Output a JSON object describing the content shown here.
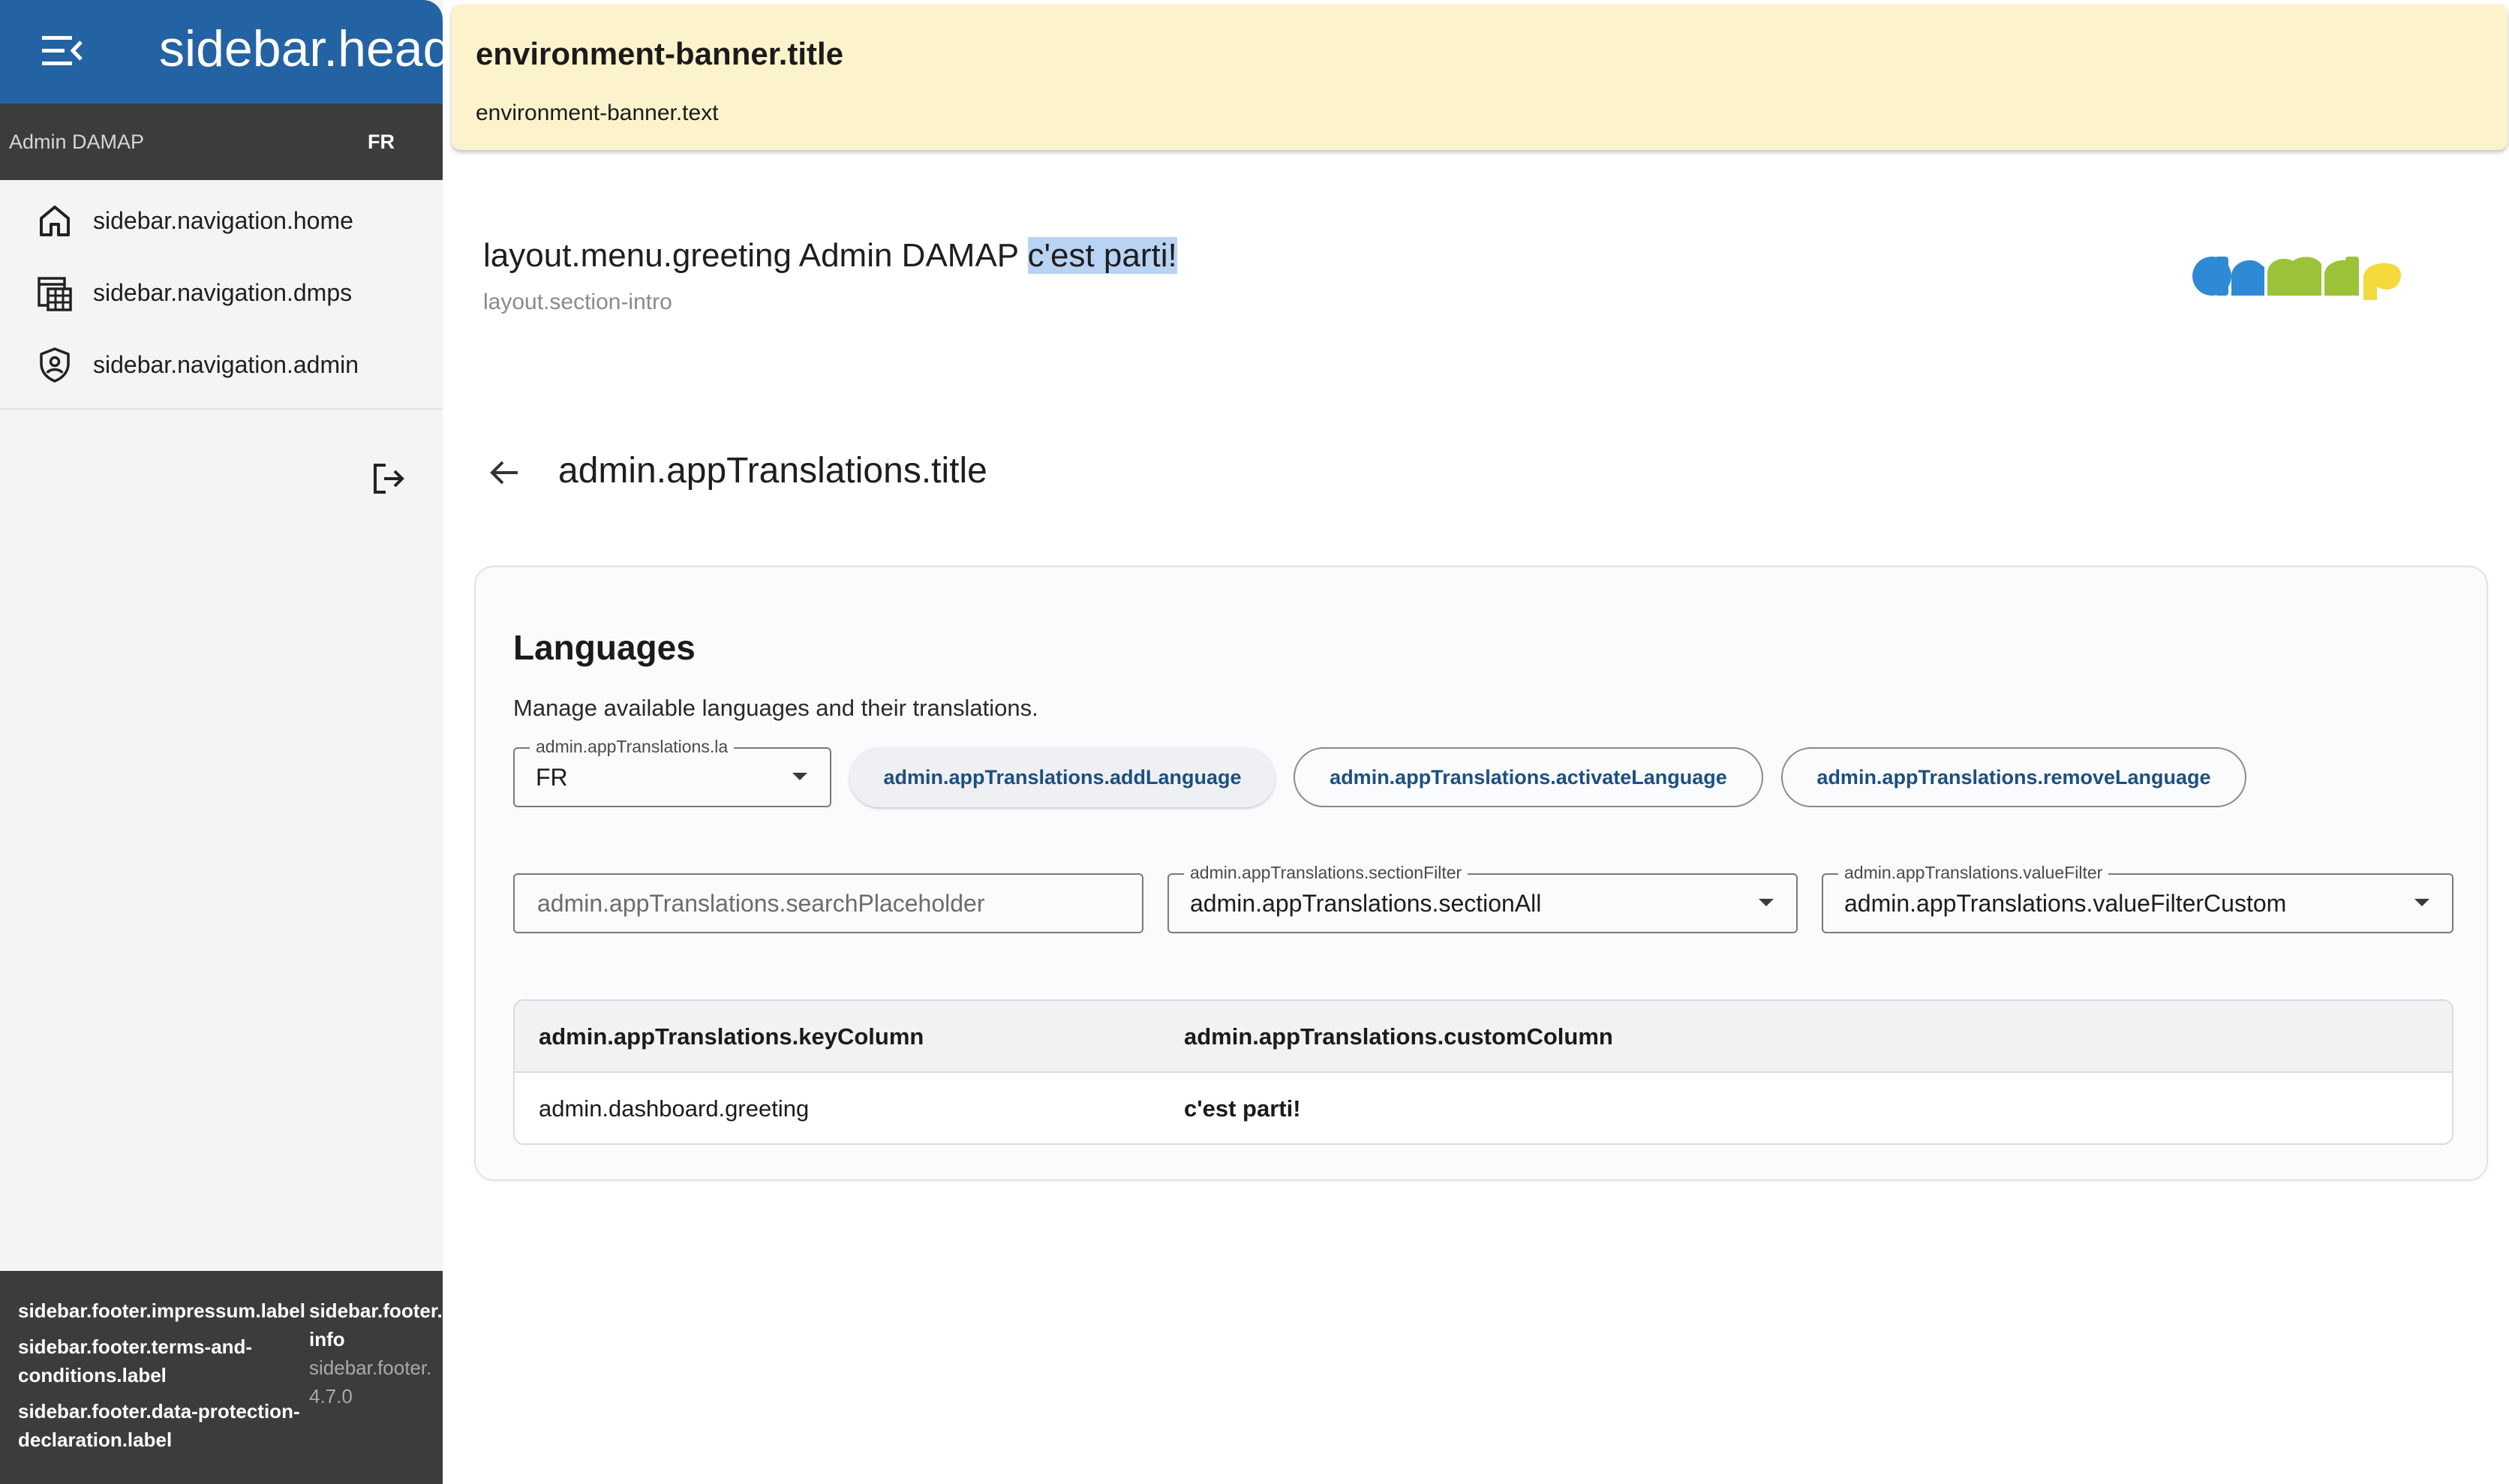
{
  "sidebar": {
    "title": "sidebar.header",
    "user": {
      "name": "Admin DAMAP",
      "language": "FR"
    },
    "nav": [
      {
        "label": "sidebar.navigation.home",
        "icon": "home-icon"
      },
      {
        "label": "sidebar.navigation.dmps",
        "icon": "table-grid-icon"
      },
      {
        "label": "sidebar.navigation.admin",
        "icon": "admin-shield-icon"
      }
    ],
    "footer": {
      "impressum": "sidebar.footer.impressum.label",
      "terms": "sidebar.footer.terms-and-conditions.label",
      "data_protection": "sidebar.footer.data-protection-declaration.label",
      "info": "sidebar.footer.",
      "info_cont": "info",
      "version_label": "sidebar.footer.",
      "version": "4.7.0"
    }
  },
  "banner": {
    "title": "environment-banner.title",
    "text": "environment-banner.text"
  },
  "header": {
    "greeting_prefix": "layout.menu.greeting Admin DAMAP ",
    "greeting_highlight": "c'est parti!",
    "section_intro": "layout.section-intro",
    "logo": "damap"
  },
  "page": {
    "title": "admin.appTranslations.title"
  },
  "languages_card": {
    "title": "Languages",
    "description": "Manage available languages and their translations.",
    "language_select": {
      "label": "admin.appTranslations.la",
      "value": "FR"
    },
    "buttons": {
      "add": "admin.appTranslations.addLanguage",
      "activate": "admin.appTranslations.activateLanguage",
      "remove": "admin.appTranslations.removeLanguage"
    },
    "search": {
      "placeholder": "admin.appTranslations.searchPlaceholder"
    },
    "section_filter": {
      "label": "admin.appTranslations.sectionFilter",
      "value": "admin.appTranslations.sectionAll"
    },
    "value_filter": {
      "label": "admin.appTranslations.valueFilter",
      "value": "admin.appTranslations.valueFilterCustom"
    },
    "table": {
      "columns": [
        "admin.appTranslations.keyColumn",
        "admin.appTranslations.customColumn"
      ],
      "rows": [
        [
          "admin.dashboard.greeting",
          "c'est parti!"
        ]
      ]
    }
  },
  "colors": {
    "sidebar_header": "#2463a3",
    "sidebar_dark": "#3c3c3c",
    "banner_bg": "#fcf3cc",
    "selection_highlight": "#b8d3f3",
    "button_text": "#1c4f82"
  }
}
